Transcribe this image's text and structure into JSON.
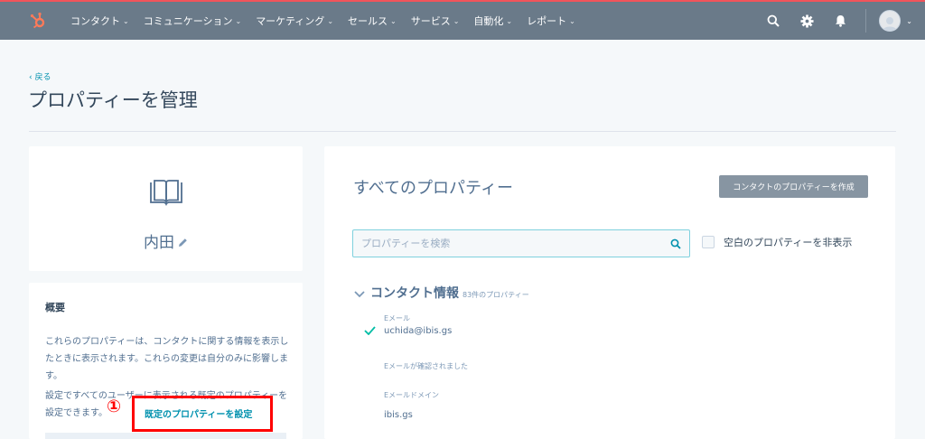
{
  "colors": {
    "nav_bg": "#6a7a89",
    "accent_line": "#f2545b",
    "link": "#0091ae",
    "annotation": "#ff0000",
    "search_border": "#7fd1de",
    "check": "#00bda5"
  },
  "topnav": {
    "logo_icon": "hubspot-sprocket-icon",
    "items": [
      {
        "label": "コンタクト"
      },
      {
        "label": "コミュニケーション"
      },
      {
        "label": "マーケティング"
      },
      {
        "label": "セールス"
      },
      {
        "label": "サービス"
      },
      {
        "label": "自動化"
      },
      {
        "label": "レポート"
      }
    ],
    "right_icons": [
      "search-icon",
      "gear-icon",
      "bell-icon",
      "avatar"
    ]
  },
  "page": {
    "back_label": "‹ 戻る",
    "title": "プロパティーを管理"
  },
  "profile": {
    "icon": "book-icon",
    "name": "内田"
  },
  "about": {
    "title": "概要",
    "text1": "これらのプロパティーは、コンタクトに関する情報を表示したときに表示されます。これらの変更は自分のみに影響します。",
    "text2": "設定ですべてのユーザーに表示される既定のプロパティーを設定できます。",
    "preset_link": "既定のプロパティーを設定",
    "annotation_number": "①"
  },
  "main": {
    "title": "すべてのプロパティー",
    "create_button": "コンタクトのプロパティーを作成",
    "search_placeholder": "プロパティーを検索",
    "hide_empty_label": "空白のプロパティーを非表示",
    "section": {
      "name": "コンタクト情報",
      "count": "83件のプロパティー"
    },
    "properties": [
      {
        "label": "Eメール",
        "value": "uchida@ibis.gs",
        "checked": true
      },
      {
        "label": "Eメールが確認されました",
        "value": ""
      },
      {
        "label": "Eメールドメイン",
        "value": "ibis.gs"
      }
    ]
  }
}
